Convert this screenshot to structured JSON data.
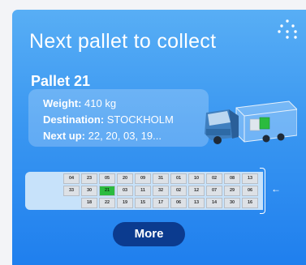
{
  "header": {
    "title": "Next pallet to collect",
    "menu_icon": "dots-grid-icon"
  },
  "pallet": {
    "name": "Pallet 21",
    "weight_label": "Weight:",
    "weight_value": "410 kg",
    "destination_label": "Destination:",
    "destination_value": "STOCKHOLM",
    "next_label": "Next up:",
    "next_value": "22, 20, 03, 19..."
  },
  "truck": {
    "icon": "truck-icon",
    "highlight_color": "#2bbb3f"
  },
  "layout": {
    "rows": [
      [
        "04",
        "23",
        "05",
        "20",
        "09",
        "31",
        "01",
        "10",
        "02",
        "08",
        "13"
      ],
      [
        "33",
        "30",
        "21",
        "03",
        "11",
        "32",
        "02",
        "12",
        "07",
        "29",
        "06"
      ],
      [
        "",
        "18",
        "22",
        "19",
        "15",
        "17",
        "06",
        "13",
        "14",
        "30",
        "16"
      ]
    ],
    "highlight": "21"
  },
  "direction_icon": "arrow-left-icon",
  "actions": {
    "more_label": "More"
  },
  "colors": {
    "accent": "#1f7fee",
    "button": "#0b3b8f",
    "highlight": "#2bbb3f"
  }
}
